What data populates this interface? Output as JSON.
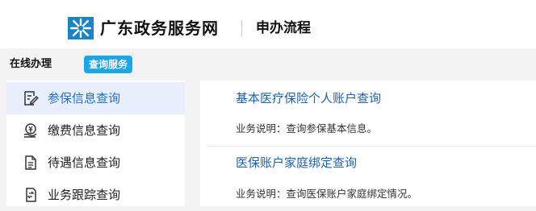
{
  "header": {
    "site_name": "广东政务服务网",
    "section_title": "申办流程"
  },
  "subnav": {
    "online_label": "在线办理",
    "query_label": "查询服务"
  },
  "sidebar": {
    "items": [
      {
        "label": "参保信息查询",
        "icon": "edit-document-icon",
        "active": true
      },
      {
        "label": "缴费信息查询",
        "icon": "payment-hand-icon"
      },
      {
        "label": "待遇信息查询",
        "icon": "document-list-icon"
      },
      {
        "label": "业务跟踪查询",
        "icon": "document-exchange-icon"
      }
    ]
  },
  "services": [
    {
      "title": "基本医疗保险个人账户查询",
      "desc": "业务说明：查询参保基本信息。"
    },
    {
      "title": "医保账户家庭绑定查询",
      "desc": "业务说明：查询医保账户家庭绑定情况。"
    }
  ],
  "colors": {
    "accent": "#1aa7e8",
    "link": "#1e5fb0",
    "active_bg": "#e9eefc"
  }
}
